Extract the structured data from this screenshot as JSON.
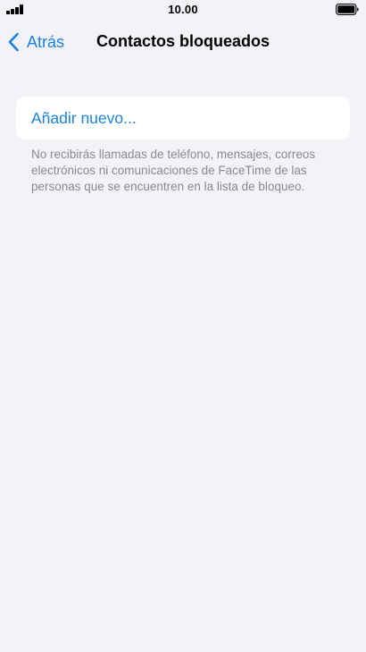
{
  "status_bar": {
    "time": "10.00",
    "signal_icon": "cellular-signal-icon",
    "battery_icon": "battery-full-icon"
  },
  "nav": {
    "back_label": "Atrás",
    "back_icon": "chevron-left-icon",
    "title": "Contactos bloqueados"
  },
  "list": {
    "add_new_label": "Añadir nuevo..."
  },
  "footer": {
    "note": "No recibirás llamadas de teléfono, mensajes, correos electrónicos ni comunicaciones de FaceTime de las personas que se encuentren en la lista de bloqueo."
  },
  "colors": {
    "accent": "#1a82e0",
    "background": "#f2f2f7",
    "secondary_text": "#8a8a8e"
  }
}
